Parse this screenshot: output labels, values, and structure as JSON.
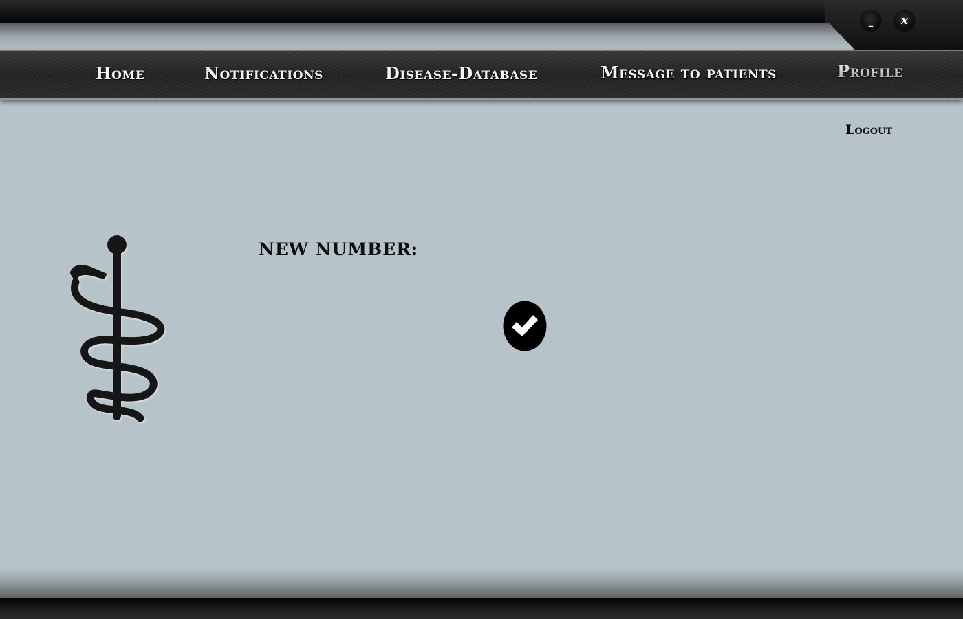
{
  "window_controls": {
    "minimize_label": "_",
    "close_label": "x"
  },
  "nav": {
    "items": [
      {
        "label": "Home"
      },
      {
        "label": "Notifications"
      },
      {
        "label": "Disease-Database"
      },
      {
        "label": "Message to patients"
      },
      {
        "label": "Profile"
      }
    ]
  },
  "logout_label": "Logout",
  "form": {
    "new_number_label": "NEW NUMBER:"
  },
  "icons": {
    "logo": "rod-of-asclepius-icon",
    "confirm": "checkmark-icon"
  },
  "colors": {
    "background": "#b6c4ca",
    "nav_background": "#2a2a2b",
    "nav_text": "#f4f4f4",
    "dark_text": "#0d0d0d"
  }
}
